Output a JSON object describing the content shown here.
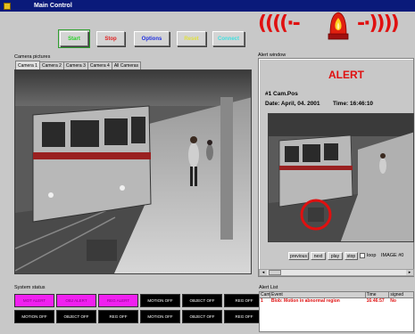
{
  "window": {
    "title": "Main Control"
  },
  "toolbar": {
    "start": "Start",
    "stop": "Stop",
    "options": "Options",
    "reset": "Reset",
    "connect": "Connect",
    "wave_left": "(((((•-",
    "wave_right": "-•)))))"
  },
  "camera": {
    "group_label": "Camera pictures",
    "tabs": [
      "Camera 1",
      "Camera 2",
      "Camera 3",
      "Camera 4",
      "All Cameras"
    ],
    "active_tab": "Camera 1"
  },
  "alert_window": {
    "group_label": "Alert window",
    "heading": "ALERT",
    "cam_line": "#1   Cam.Pos",
    "date_line": "Date:  April, 04. 2001",
    "time_line": "Time:  16:46:10",
    "buttons": {
      "previous": "previous",
      "next": "next",
      "play": "play",
      "stop": "stop"
    },
    "loop_label": "loop",
    "image_counter": "IMAGE #0"
  },
  "system_status": {
    "group_label": "System status",
    "rows": [
      [
        "MOT ALERT",
        "OBJ ALERT",
        "REG ALERT",
        "MOTION OFF",
        "OBJECT OFF",
        "REG OFF"
      ],
      [
        "MOTION OFF",
        "OBJECT OFF",
        "REG OFF",
        "MOTION OFF",
        "OBJECT OFF",
        "REG OFF"
      ]
    ],
    "colors": {
      "alert": "#f020f0",
      "off": "#000000"
    }
  },
  "alert_list": {
    "group_label": "Alert List",
    "headers": [
      "Cam",
      "Event",
      "Time",
      "signed"
    ],
    "rows": [
      {
        "cam": "1",
        "event": "Blob: Motion in abnormal region",
        "time": "16:46:57",
        "signed": "No"
      }
    ]
  },
  "colors": {
    "accent_red": "#e01010",
    "titlebar": "#0a1a7a"
  }
}
